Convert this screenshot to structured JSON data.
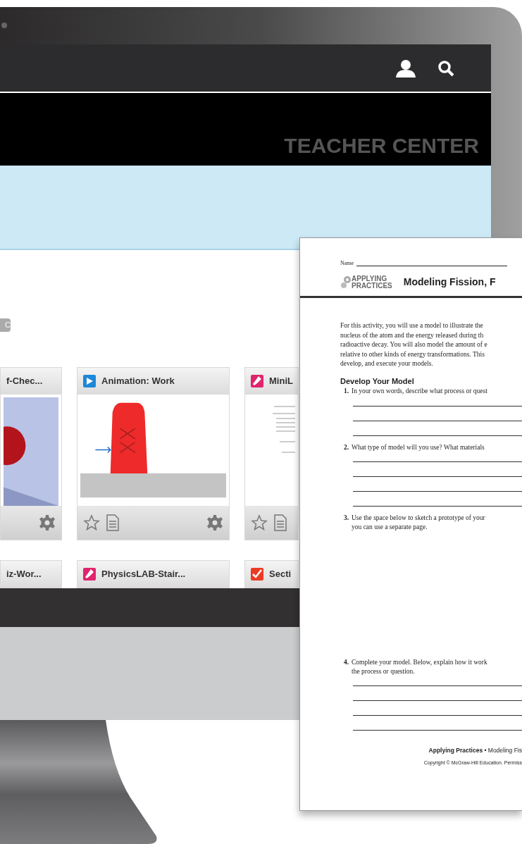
{
  "header": {
    "title": "TEACHER CENTER"
  },
  "filter_chip": "C",
  "card_rows": [
    {
      "kind": "full",
      "cards": [
        {
          "title": "f-Chec...",
          "cut_left": true,
          "cut_right": false
        },
        {
          "title": "Animation: Work",
          "kind": "play",
          "cut_left": false,
          "cut_right": false
        },
        {
          "title": "MiniL",
          "kind": "flask",
          "cut_left": false,
          "cut_right": true
        }
      ]
    },
    {
      "kind": "headers",
      "cards": [
        {
          "title": "iz-Wor...",
          "cut_left": true,
          "cut_right": false
        },
        {
          "title": "PhysicsLAB-Stair...",
          "kind": "flask",
          "cut_left": false,
          "cut_right": false
        },
        {
          "title": "Secti",
          "kind": "check",
          "cut_left": false,
          "cut_right": true
        }
      ]
    }
  ],
  "worksheet": {
    "name_label": "Name",
    "logo": [
      "APPLYING",
      "PRACTICES"
    ],
    "title": "Modeling Fission, F",
    "intro": [
      "For this activity, you will use a model to illustrate the",
      "nucleus of the atom and the energy released during th",
      "radioactive decay. You will also model the amount of e",
      "relative to other kinds of energy transformations.  This",
      "develop, and execute your models."
    ],
    "section": "Develop Your Model",
    "questions": [
      {
        "number": "1.",
        "lines": [
          "In your own words, describe what process or quest"
        ],
        "kind": "three_lines"
      },
      {
        "number": "2.",
        "lines": [
          "What type of model will you use? What materials"
        ],
        "kind": "four_lines"
      },
      {
        "number": "3.",
        "lines": [
          "Use the space below to sketch a prototype of your",
          "you can use a separate page."
        ],
        "kind": "sketch_area"
      },
      {
        "number": "4.",
        "lines": [
          "Complete your model. Below, explain how it work",
          "the process or question."
        ],
        "kind": "four_lines"
      }
    ],
    "footer": "**Applying Practices** • Modeling Fis",
    "copyright": "Copyright © McGraw-Hill Education. Permiss"
  }
}
